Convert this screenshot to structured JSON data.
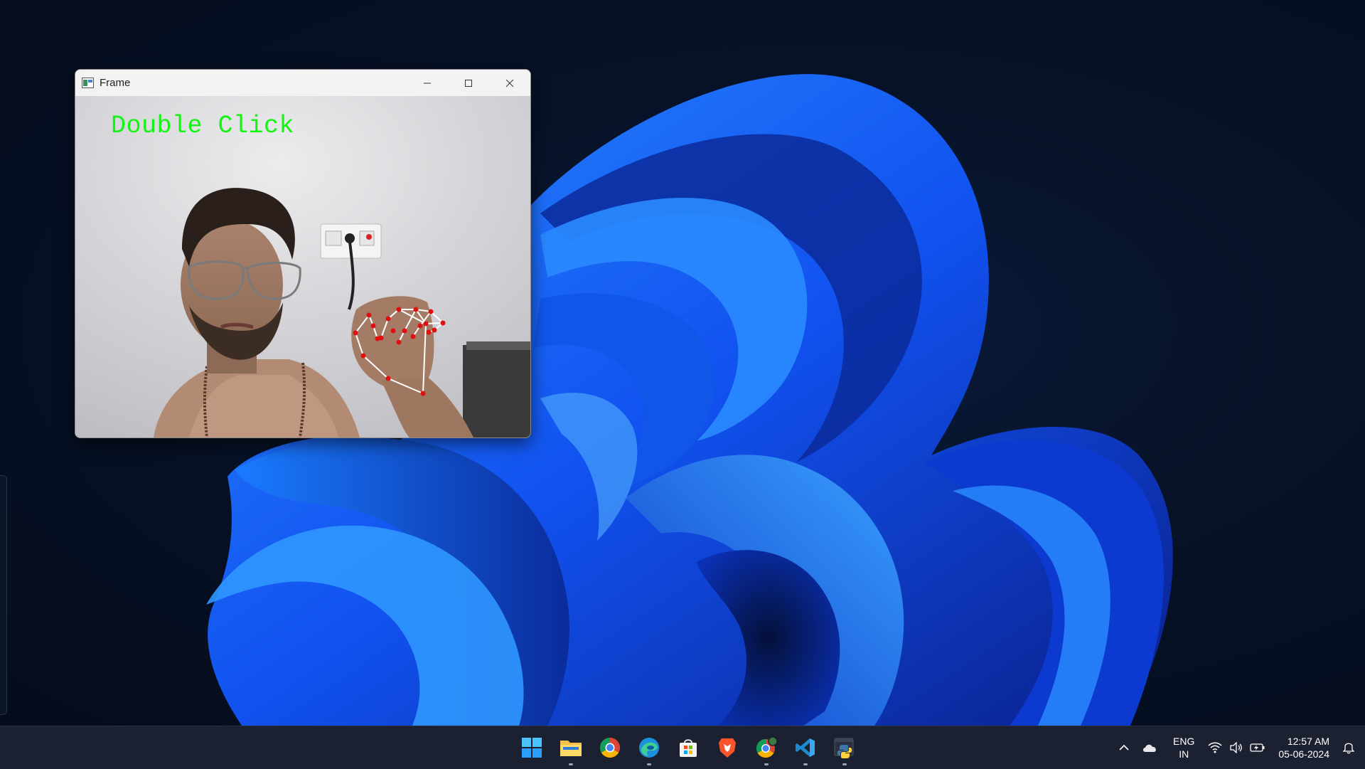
{
  "window": {
    "title": "Frame",
    "overlay_label": "Double Click",
    "controls": [
      "minimize",
      "maximize",
      "close"
    ]
  },
  "taskbar": {
    "pinned": [
      {
        "name": "start",
        "icon": "windows-logo-icon",
        "running": false
      },
      {
        "name": "file-explorer",
        "icon": "folder-icon",
        "running": true
      },
      {
        "name": "chrome",
        "icon": "chrome-icon",
        "running": false
      },
      {
        "name": "edge",
        "icon": "edge-icon",
        "running": true
      },
      {
        "name": "microsoft-store",
        "icon": "store-icon",
        "running": false
      },
      {
        "name": "brave",
        "icon": "brave-icon",
        "running": false
      },
      {
        "name": "chrome-profile",
        "icon": "chrome-profile-icon",
        "running": true
      },
      {
        "name": "vs-code",
        "icon": "vscode-icon",
        "running": true
      },
      {
        "name": "python",
        "icon": "python-icon",
        "running": true
      }
    ],
    "tray": {
      "language_top": "ENG",
      "language_bottom": "IN",
      "time": "12:57 AM",
      "date": "05-06-2024",
      "icons": [
        "chevron-up-icon",
        "cloud-icon",
        "wifi-icon",
        "speaker-icon",
        "battery-icon",
        "bell-icon"
      ]
    }
  },
  "colors": {
    "overlay_text": "#11f511",
    "landmark": "#e01010",
    "taskbar_bg": "#1b2130",
    "wallpaper_blue": "#1560ff"
  }
}
